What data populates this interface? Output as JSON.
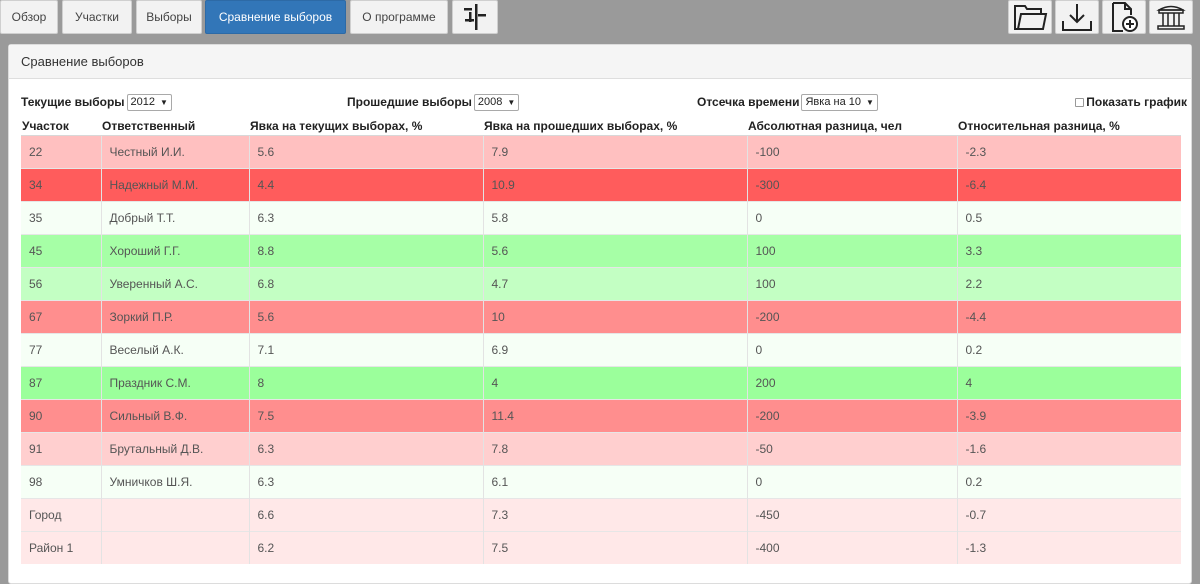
{
  "nav": {
    "tabs": [
      {
        "label": "Обзор"
      },
      {
        "label": "Участки"
      },
      {
        "label": "Выборы"
      },
      {
        "label": "Сравнение выборов"
      },
      {
        "label": "О программе"
      }
    ],
    "active_tab": "Сравнение выборов",
    "icons": [
      "filter-settings-icon",
      "folder-open-icon",
      "download-icon",
      "new-file-icon",
      "capitol-building-icon"
    ]
  },
  "panel": {
    "title": "Сравнение выборов"
  },
  "controls": {
    "current_label": "Текущие выборы",
    "current_value": "2012",
    "past_label": "Прошедшие выборы",
    "past_value": "2008",
    "cutoff_label": "Отсечка времени",
    "cutoff_value": "Явка на 10",
    "show_chart_label": "Показать график"
  },
  "table": {
    "headers": [
      "Участок",
      "Ответственный",
      "Явка на текущих выборах, %",
      "Явка на прошедших выборах, %",
      "Абсолютная разница, чел",
      "Относительная разница, %"
    ],
    "rows": [
      {
        "cells": [
          "22",
          "Честный И.И.",
          "5.6",
          "7.9",
          "-100",
          "-2.3"
        ],
        "color": "#ffc0c0"
      },
      {
        "cells": [
          "34",
          "Надежный М.М.",
          "4.4",
          "10.9",
          "-300",
          "-6.4"
        ],
        "color": "#ff5c5c"
      },
      {
        "cells": [
          "35",
          "Добрый Т.Т.",
          "6.3",
          "5.8",
          "0",
          "0.5"
        ],
        "color": "#f6fff6"
      },
      {
        "cells": [
          "45",
          "Хороший Г.Г.",
          "8.8",
          "5.6",
          "100",
          "3.3"
        ],
        "color": "#a6ffa6"
      },
      {
        "cells": [
          "56",
          "Уверенный А.С.",
          "6.8",
          "4.7",
          "100",
          "2.2"
        ],
        "color": "#c3ffc3"
      },
      {
        "cells": [
          "67",
          "Зоркий П.Р.",
          "5.6",
          "10",
          "-200",
          "-4.4"
        ],
        "color": "#ff8e8e"
      },
      {
        "cells": [
          "77",
          "Веселый А.К.",
          "7.1",
          "6.9",
          "0",
          "0.2"
        ],
        "color": "#f6fff6"
      },
      {
        "cells": [
          "87",
          "Праздник С.М.",
          "8",
          "4",
          "200",
          "4"
        ],
        "color": "#9bff9b"
      },
      {
        "cells": [
          "90",
          "Сильный В.Ф.",
          "7.5",
          "11.4",
          "-200",
          "-3.9"
        ],
        "color": "#ff8e8e"
      },
      {
        "cells": [
          "91",
          "Брутальный Д.В.",
          "6.3",
          "7.8",
          "-50",
          "-1.6"
        ],
        "color": "#ffcfcf"
      },
      {
        "cells": [
          "98",
          "Умничков Ш.Я.",
          "6.3",
          "6.1",
          "0",
          "0.2"
        ],
        "color": "#f6fff6"
      },
      {
        "cells": [
          "Город",
          "",
          "6.6",
          "7.3",
          "-450",
          "-0.7"
        ],
        "color": "#ffe8e8"
      },
      {
        "cells": [
          "Район 1",
          "",
          "6.2",
          "7.5",
          "-400",
          "-1.3"
        ],
        "color": "#ffe8e8"
      }
    ]
  },
  "colors": {
    "active_tab": "#3276b8",
    "background": "#9a9a9a"
  }
}
